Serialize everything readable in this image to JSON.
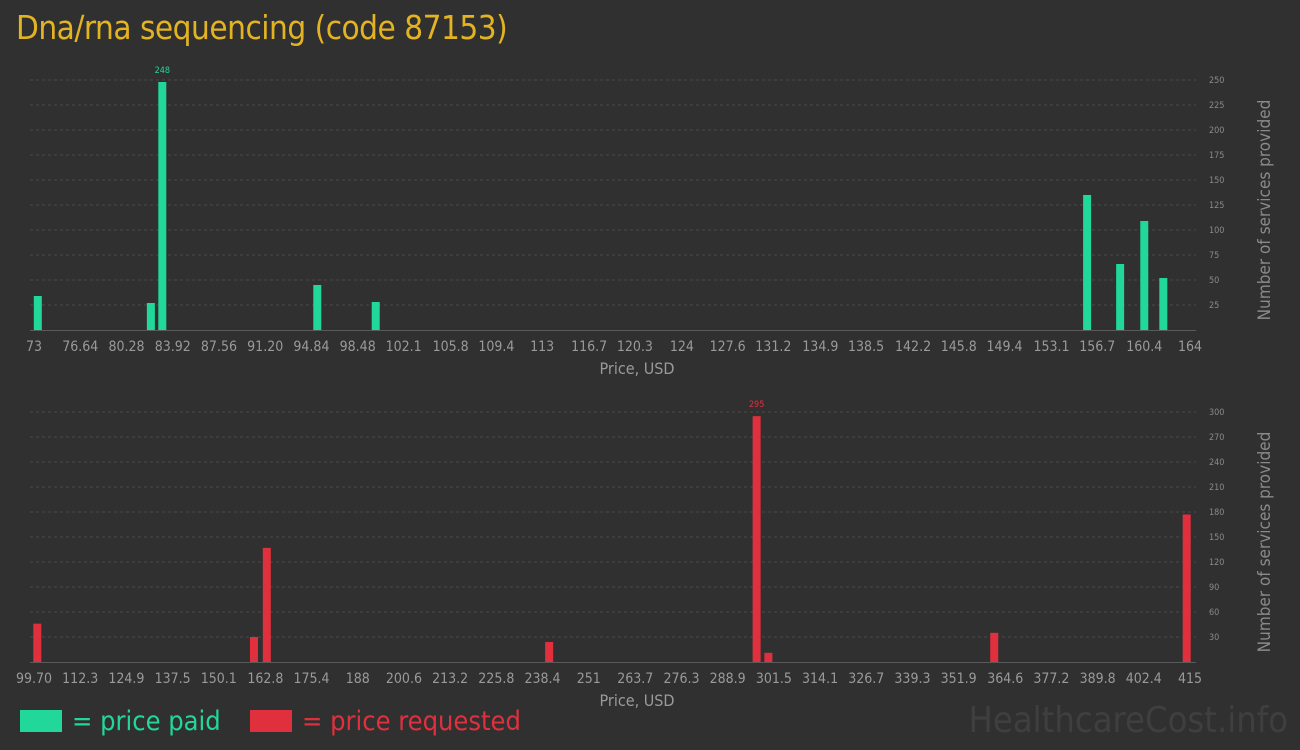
{
  "page": {
    "title": "Dna/rna sequencing (code 87153)",
    "watermark": "HealthcareCost.info",
    "legend": [
      {
        "label": "= price paid",
        "color": "#21d79a"
      },
      {
        "label": "= price requested",
        "color": "#e0303e"
      }
    ]
  },
  "chart_data": [
    {
      "type": "bar",
      "color": "#21d79a",
      "xlabel": "Price, USD",
      "ylabel": "Number of services provided",
      "xlim": [
        73,
        164
      ],
      "ylim": [
        0,
        250
      ],
      "yticks": [
        25,
        50,
        75,
        100,
        125,
        150,
        175,
        200,
        225,
        250
      ],
      "x_tick_labels": [
        "73",
        "76.64",
        "80.28",
        "83.92",
        "87.56",
        "91.20",
        "94.84",
        "98.48",
        "102.1",
        "105.8",
        "109.4",
        "113",
        "116.7",
        "120.3",
        "124",
        "127.6",
        "131.2",
        "134.9",
        "138.5",
        "142.2",
        "145.8",
        "149.4",
        "153.1",
        "156.7",
        "160.4",
        "164"
      ],
      "x_tick_values": [
        73,
        76.64,
        80.28,
        83.92,
        87.56,
        91.2,
        94.84,
        98.48,
        102.1,
        105.8,
        109.4,
        113,
        116.7,
        120.3,
        124,
        127.6,
        131.2,
        134.9,
        138.5,
        142.2,
        145.8,
        149.4,
        153.1,
        156.7,
        160.4,
        164
      ],
      "bars": [
        {
          "x": 73.3,
          "y": 34
        },
        {
          "x": 82.2,
          "y": 27
        },
        {
          "x": 83.1,
          "y": 248,
          "label": "248"
        },
        {
          "x": 95.3,
          "y": 45
        },
        {
          "x": 99.9,
          "y": 28
        },
        {
          "x": 155.9,
          "y": 135
        },
        {
          "x": 158.5,
          "y": 66
        },
        {
          "x": 160.4,
          "y": 109
        },
        {
          "x": 161.9,
          "y": 52
        }
      ]
    },
    {
      "type": "bar",
      "color": "#e0303e",
      "xlabel": "Price, USD",
      "ylabel": "Number of services provided",
      "xlim": [
        99.7,
        415
      ],
      "ylim": [
        0,
        300
      ],
      "yticks": [
        30,
        60,
        90,
        120,
        150,
        180,
        210,
        240,
        270,
        300
      ],
      "x_tick_labels": [
        "99.70",
        "112.3",
        "124.9",
        "137.5",
        "150.1",
        "162.8",
        "175.4",
        "188",
        "200.6",
        "213.2",
        "225.8",
        "238.4",
        "251",
        "263.7",
        "276.3",
        "288.9",
        "301.5",
        "314.1",
        "326.7",
        "339.3",
        "351.9",
        "364.6",
        "377.2",
        "389.8",
        "402.4",
        "415"
      ],
      "x_tick_values": [
        99.7,
        112.3,
        124.9,
        137.5,
        150.1,
        162.8,
        175.4,
        188,
        200.6,
        213.2,
        225.8,
        238.4,
        251,
        263.7,
        276.3,
        288.9,
        301.5,
        314.1,
        326.7,
        339.3,
        351.9,
        364.6,
        377.2,
        389.8,
        402.4,
        415
      ],
      "bars": [
        {
          "x": 100.6,
          "y": 46
        },
        {
          "x": 159.7,
          "y": 30
        },
        {
          "x": 163.2,
          "y": 137
        },
        {
          "x": 240.2,
          "y": 24
        },
        {
          "x": 296.8,
          "y": 295,
          "label": "295"
        },
        {
          "x": 300.0,
          "y": 11
        },
        {
          "x": 361.6,
          "y": 35
        },
        {
          "x": 414.1,
          "y": 177
        }
      ]
    }
  ]
}
